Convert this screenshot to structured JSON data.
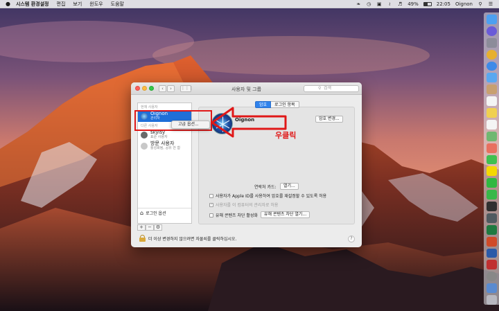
{
  "menubar": {
    "app_name": "시스템 환경설정",
    "items": [
      "편집",
      "보기",
      "윈도우",
      "도움말"
    ],
    "battery_percent": "49%",
    "battery_level": 0.49,
    "time": "22:05",
    "user": "Oignon"
  },
  "window": {
    "title": "사용자 및 그룹",
    "search_placeholder": "검색",
    "sidebar": {
      "current_user_section": "현재 사용자",
      "other_users_section": "다른 사용자",
      "users": [
        {
          "name": "Oignon",
          "role": "관리자",
          "selected": true
        },
        {
          "name": "skylsy",
          "role": "표준 사용자",
          "selected": false
        },
        {
          "name": "방문 사용자",
          "role": "활성화됨, 공유 안 함",
          "selected": false
        }
      ],
      "login_options": "로그인 옵션",
      "add_label": "+",
      "remove_label": "−",
      "gear_label": "⚙"
    },
    "tabs": {
      "password": "암호",
      "login_items": "로그인 항목"
    },
    "profile_name": "Oignon",
    "change_password_button": "암호 변경...",
    "contact_card_label": "연락처 카드:",
    "open_button": "열기...",
    "options": [
      {
        "label": "사용자가 Apple ID를 사용하여 암호를 재설정할 수 있도록 허용",
        "checked": false,
        "disabled": false
      },
      {
        "label": "사용자를 이 컴퓨터의 관리자로 허용",
        "checked": true,
        "disabled": true
      },
      {
        "label": "유해 콘텐츠 차단 활성화",
        "checked": false,
        "disabled": false
      }
    ],
    "parental_open_button": "유해 콘텐츠 차단 열기...",
    "lock_text": "더 이상 변경하지 않으려면 자물쇠를 클릭하십시오.",
    "help_label": "?"
  },
  "context_menu": {
    "item": "고급 옵션..."
  },
  "annotation": {
    "label": "우클릭",
    "color": "#e01818"
  },
  "colors": {
    "selection": "#1f6fd8",
    "active_tab": "#2f82ec"
  }
}
